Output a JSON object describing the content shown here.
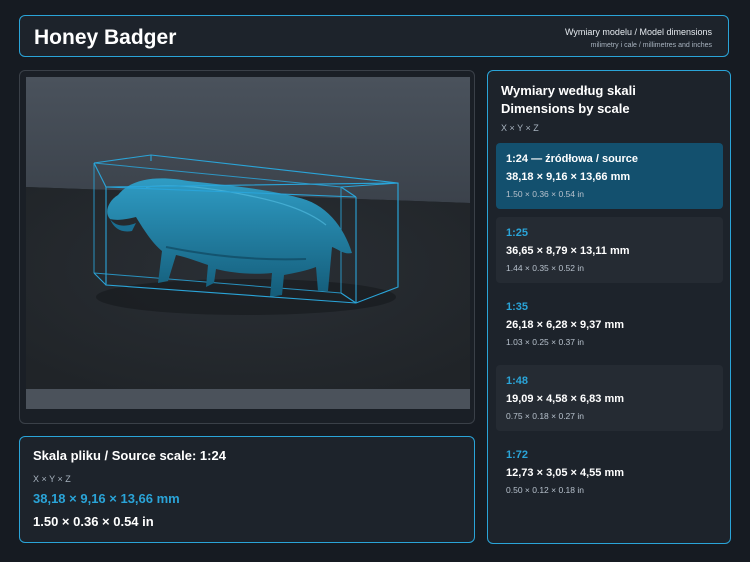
{
  "header": {
    "title": "Honey Badger",
    "subtitle": "Wymiary modelu / Model dimensions",
    "units_note": "milimetry i cale / millimetres and inches"
  },
  "viewer": {
    "model_color": "#1f7fa3",
    "box_color": "#2aa4d8"
  },
  "source": {
    "heading": "Skala pliku / Source scale: 1:24",
    "axis_label": "X × Y × Z",
    "mm": "38,18 × 9,16 × 13,66 mm",
    "inches": "1.50 × 0.36 × 0.54 in"
  },
  "scales": {
    "heading_pl": "Wymiary według skali",
    "heading_en": "Dimensions by scale",
    "axis_label": "X × Y × Z",
    "rows": [
      {
        "scale": "1:24  —  źródłowa / source",
        "mm": "38,18 × 9,16 × 13,66 mm",
        "inches": "1.50 × 0.36 × 0.54 in"
      },
      {
        "scale": "1:25",
        "mm": "36,65 × 8,79 × 13,11 mm",
        "inches": "1.44 × 0.35 × 0.52 in"
      },
      {
        "scale": "1:35",
        "mm": "26,18 × 6,28 × 9,37 mm",
        "inches": "1.03 × 0.25 × 0.37 in"
      },
      {
        "scale": "1:48",
        "mm": "19,09 × 4,58 × 6,83 mm",
        "inches": "0.75 × 0.18 × 0.27 in"
      },
      {
        "scale": "1:72",
        "mm": "12,73 × 3,05 × 4,55 mm",
        "inches": "0.50 × 0.12 × 0.18 in"
      }
    ]
  },
  "colors": {
    "accent": "#2aa4d8",
    "background": "#161b22",
    "panel": "#1d232b",
    "active_row": "#13506e"
  }
}
